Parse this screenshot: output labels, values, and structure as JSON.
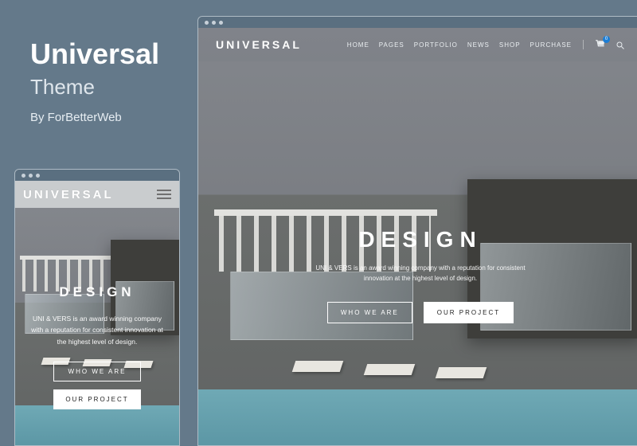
{
  "title": {
    "name": "Universal",
    "kind": "Theme",
    "author": "By ForBetterWeb"
  },
  "nav": {
    "logo": "UNIVERSAL",
    "items": [
      "HOME",
      "PAGES",
      "PORTFOLIO",
      "NEWS",
      "SHOP",
      "PURCHASE"
    ],
    "cart_count": "0"
  },
  "hero": {
    "headline": "DESIGN",
    "sub_line1": "UNI & VERS is an award winning company with a reputation for consistent",
    "sub_line2": "innovation at the highest level of design.",
    "sub_full": "UNI & VERS is an award winning company with a reputation for consistent innovation at the highest level of design.",
    "btn_primary": "WHO WE ARE",
    "btn_secondary": "OUR PROJECT"
  }
}
